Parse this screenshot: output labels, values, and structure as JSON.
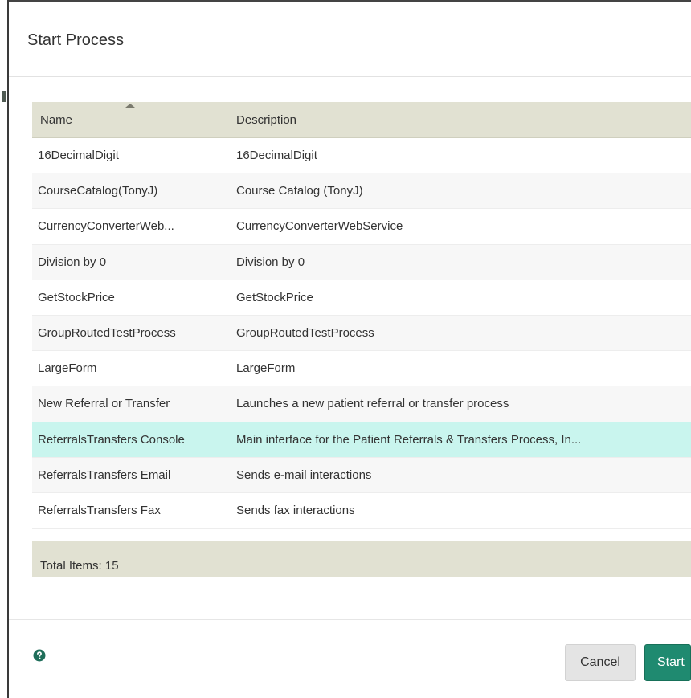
{
  "dialog": {
    "title": "Start Process"
  },
  "grid": {
    "columns": {
      "name": "Name",
      "description": "Description"
    },
    "sort": {
      "column": "Name",
      "direction": "ascending"
    },
    "rows": [
      {
        "name": "16DecimalDigit",
        "description": "16DecimalDigit"
      },
      {
        "name": "CourseCatalog(TonyJ)",
        "description": "Course Catalog (TonyJ)"
      },
      {
        "name": "CurrencyConverterWeb...",
        "description": "CurrencyConverterWebService"
      },
      {
        "name": "Division by 0",
        "description": "Division by 0"
      },
      {
        "name": "GetStockPrice",
        "description": "GetStockPrice"
      },
      {
        "name": "GroupRoutedTestProcess",
        "description": "GroupRoutedTestProcess"
      },
      {
        "name": "LargeForm",
        "description": "LargeForm"
      },
      {
        "name": "New Referral or Transfer",
        "description": "Launches a new patient referral or transfer process"
      },
      {
        "name": "ReferralsTransfers Console",
        "description": "Main interface for the Patient Referrals & Transfers Process, In..."
      },
      {
        "name": "ReferralsTransfers Email",
        "description": "Sends e-mail interactions"
      },
      {
        "name": "ReferralsTransfers Fax",
        "description": "Sends fax interactions"
      }
    ],
    "selected_row_index": 8,
    "footer": {
      "total_items": "Total Items: 15"
    }
  },
  "footer": {
    "help_icon": "help-circle-icon",
    "cancel_label": "Cancel",
    "start_label": "Start"
  },
  "colors": {
    "header_bg": "#e1e1d2",
    "selected_row_bg": "#c9f5ee",
    "primary_button": "#1f8a70",
    "help_icon": "#1f6e5a"
  }
}
